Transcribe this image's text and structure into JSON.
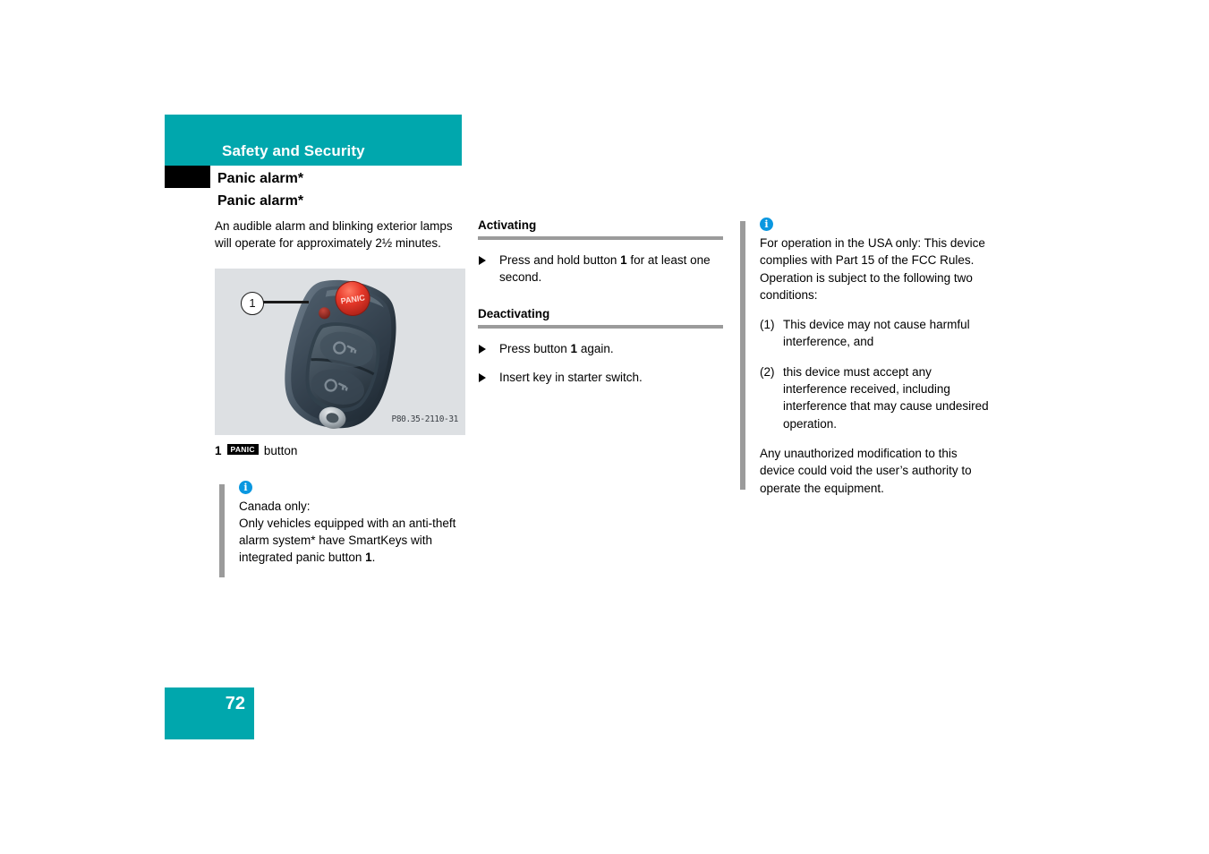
{
  "header": {
    "chapter": "Safety and Security",
    "section_title": "Panic alarm*",
    "topic_title": "Panic alarm*"
  },
  "left_column": {
    "intro": "An audible alarm and blinking exterior lamps will operate for approximately 2½ minutes.",
    "figure": {
      "callout_number": "1",
      "image_code": "P80.35-2110-31",
      "alt_name": "smartkey-with-panic-button"
    },
    "caption": {
      "number": "1",
      "badge": "PANIC",
      "text": "button"
    },
    "note": {
      "icon": "info-icon",
      "line1": "Canada only:",
      "line2": "Only vehicles equipped with an anti-theft alarm system* have SmartKeys with integrated panic button ",
      "line2_bold": "1",
      "line2_end": "."
    }
  },
  "mid_column": {
    "activating": {
      "heading": "Activating",
      "bullet_pre": "Press and hold button ",
      "bullet_bold": "1",
      "bullet_post": " for at least one second."
    },
    "deactivating": {
      "heading": "Deactivating",
      "bullet1_pre": "Press button ",
      "bullet1_bold": "1",
      "bullet1_post": " again.",
      "bullet2": "Insert key in starter switch."
    }
  },
  "right_column": {
    "icon": "info-icon",
    "intro": "For operation in the USA only: This device complies with Part 15 of the FCC Rules. Operation is subject to the following two conditions:",
    "conditions": [
      {
        "num": "(1)",
        "text": "This device may not cause harmful interference, and"
      },
      {
        "num": "(2)",
        "text": "this device must accept any interference received, including interference that may cause undesired operation."
      }
    ],
    "closing": "Any unauthorized modification to this device could void the user’s authority to operate the equipment."
  },
  "footer": {
    "page_number": "72"
  },
  "colors": {
    "accent_teal": "#00a7ad",
    "info_blue": "#0a97e0",
    "rule_gray": "#9b9b9b",
    "figure_bg": "#dde0e3",
    "black": "#000000"
  }
}
